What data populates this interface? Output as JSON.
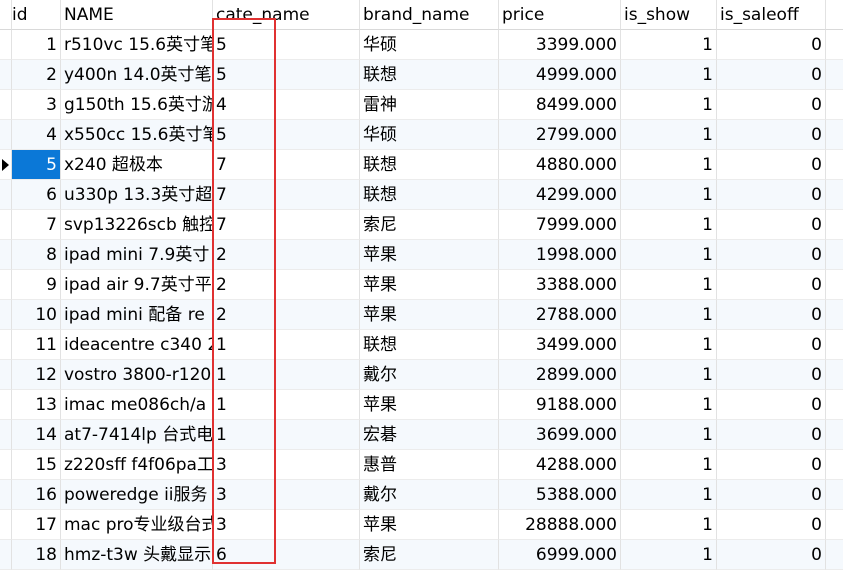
{
  "columns": {
    "id": "id",
    "name": "NAME",
    "cate_name": "cate_name",
    "brand_name": "brand_name",
    "price": "price",
    "is_show": "is_show",
    "is_saleoff": "is_saleoff"
  },
  "selected_row": 5,
  "highlight_color": "#e03131",
  "selection_color": "#0b78d7",
  "rows": [
    {
      "id": "1",
      "name": "r510vc 15.6英寸笔",
      "cate": "5",
      "brand": "华硕",
      "price": "3399.000",
      "show": "1",
      "sale": "0"
    },
    {
      "id": "2",
      "name": "y400n 14.0英寸笔",
      "cate": "5",
      "brand": "联想",
      "price": "4999.000",
      "show": "1",
      "sale": "0"
    },
    {
      "id": "3",
      "name": "g150th 15.6英寸游",
      "cate": "4",
      "brand": "雷神",
      "price": "8499.000",
      "show": "1",
      "sale": "0"
    },
    {
      "id": "4",
      "name": "x550cc 15.6英寸笔",
      "cate": "5",
      "brand": "华硕",
      "price": "2799.000",
      "show": "1",
      "sale": "0"
    },
    {
      "id": "5",
      "name": "x240 超极本",
      "cate": "7",
      "brand": "联想",
      "price": "4880.000",
      "show": "1",
      "sale": "0"
    },
    {
      "id": "6",
      "name": "u330p 13.3英寸超",
      "cate": "7",
      "brand": "联想",
      "price": "4299.000",
      "show": "1",
      "sale": "0"
    },
    {
      "id": "7",
      "name": "svp13226scb 触控",
      "cate": "7",
      "brand": "索尼",
      "price": "7999.000",
      "show": "1",
      "sale": "0"
    },
    {
      "id": "8",
      "name": "ipad mini 7.9英寸",
      "cate": "2",
      "brand": "苹果",
      "price": "1998.000",
      "show": "1",
      "sale": "0"
    },
    {
      "id": "9",
      "name": "ipad air 9.7英寸平",
      "cate": "2",
      "brand": "苹果",
      "price": "3388.000",
      "show": "1",
      "sale": "0"
    },
    {
      "id": "10",
      "name": "ipad mini 配备 re",
      "cate": "2",
      "brand": "苹果",
      "price": "2788.000",
      "show": "1",
      "sale": "0"
    },
    {
      "id": "11",
      "name": "ideacentre c340 2",
      "cate": "1",
      "brand": "联想",
      "price": "3499.000",
      "show": "1",
      "sale": "0"
    },
    {
      "id": "12",
      "name": "vostro 3800-r120",
      "cate": "1",
      "brand": "戴尔",
      "price": "2899.000",
      "show": "1",
      "sale": "0"
    },
    {
      "id": "13",
      "name": "imac me086ch/a",
      "cate": "1",
      "brand": "苹果",
      "price": "9188.000",
      "show": "1",
      "sale": "0"
    },
    {
      "id": "14",
      "name": "at7-7414lp 台式电",
      "cate": "1",
      "brand": "宏碁",
      "price": "3699.000",
      "show": "1",
      "sale": "0"
    },
    {
      "id": "15",
      "name": "z220sff f4f06pa工",
      "cate": "3",
      "brand": "惠普",
      "price": "4288.000",
      "show": "1",
      "sale": "0"
    },
    {
      "id": "16",
      "name": "poweredge ii服务",
      "cate": "3",
      "brand": "戴尔",
      "price": "5388.000",
      "show": "1",
      "sale": "0"
    },
    {
      "id": "17",
      "name": "mac pro专业级台式",
      "cate": "3",
      "brand": "苹果",
      "price": "28888.000",
      "show": "1",
      "sale": "0"
    },
    {
      "id": "18",
      "name": "hmz-t3w 头戴显示",
      "cate": "6",
      "brand": "索尼",
      "price": "6999.000",
      "show": "1",
      "sale": "0"
    }
  ]
}
